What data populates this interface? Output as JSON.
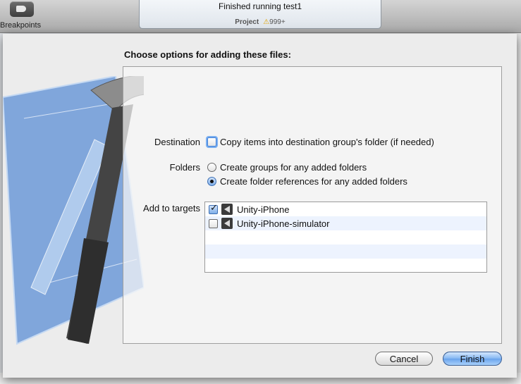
{
  "toolbar": {
    "breakpoints_label": "Breakpoints",
    "activity": {
      "title": "Finished running test1",
      "project_label": "Project",
      "warning_count": "999+"
    }
  },
  "dialog": {
    "title": "Choose options for adding these files:",
    "destination": {
      "label": "Destination",
      "copy_items": {
        "label": "Copy items into destination group's folder (if needed)",
        "checked": false
      }
    },
    "folders": {
      "label": "Folders",
      "options": [
        {
          "label": "Create groups for any added folders",
          "selected": false
        },
        {
          "label": "Create folder references for any added folders",
          "selected": true
        }
      ]
    },
    "targets": {
      "label": "Add to targets",
      "items": [
        {
          "name": "Unity-iPhone",
          "checked": true
        },
        {
          "name": "Unity-iPhone-simulator",
          "checked": false
        }
      ]
    },
    "buttons": {
      "cancel": "Cancel",
      "finish": "Finish"
    }
  },
  "icons": [
    "breakpoints-icon",
    "warning-icon",
    "xcode-hammer-icon",
    "unity-icon"
  ],
  "colors": {
    "accent": "#6aa3ec",
    "warning": "#e0a400",
    "row_alt": "#edf3fe"
  }
}
